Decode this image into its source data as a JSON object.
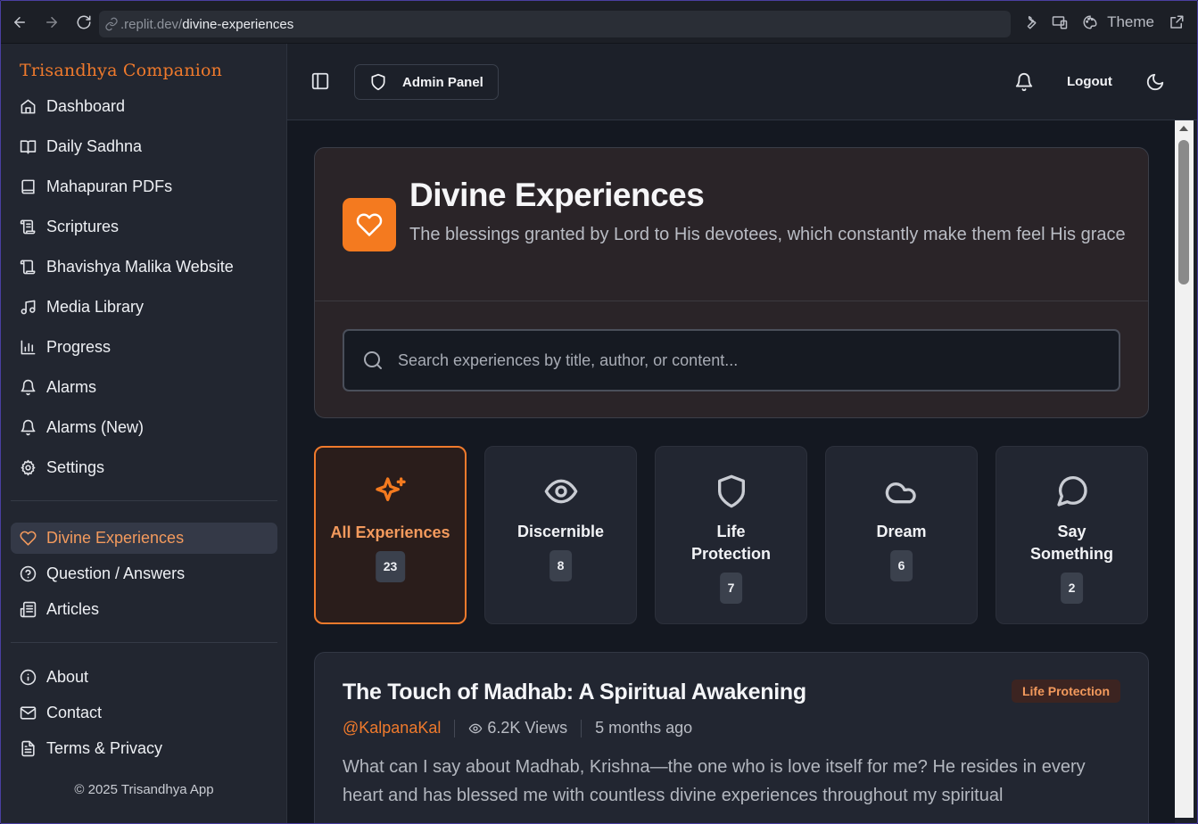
{
  "browser": {
    "url_domain": ".replit.dev/",
    "url_path": "divine-experiences",
    "theme_label": "Theme"
  },
  "sidebar": {
    "brand": "Trisandhya Companion",
    "items": [
      {
        "label": "Dashboard",
        "icon": "home-icon"
      },
      {
        "label": "Daily Sadhna",
        "icon": "book-open-icon"
      },
      {
        "label": "Mahapuran PDFs",
        "icon": "book-icon"
      },
      {
        "label": "Scriptures",
        "icon": "scroll-icon"
      },
      {
        "label": "Bhavishya Malika Website",
        "icon": "scroll-icon"
      },
      {
        "label": "Media Library",
        "icon": "music-icon"
      },
      {
        "label": "Progress",
        "icon": "bar-chart-icon"
      },
      {
        "label": "Alarms",
        "icon": "bell-icon"
      },
      {
        "label": "Alarms (New)",
        "icon": "bell-icon"
      },
      {
        "label": "Settings",
        "icon": "gear-icon"
      }
    ],
    "secondary": [
      {
        "label": "Divine Experiences",
        "icon": "heart-icon",
        "active": true
      },
      {
        "label": "Question / Answers",
        "icon": "help-circle-icon"
      },
      {
        "label": "Articles",
        "icon": "newspaper-icon"
      }
    ],
    "footer_links": [
      {
        "label": "About",
        "icon": "info-icon"
      },
      {
        "label": "Contact",
        "icon": "mail-icon"
      },
      {
        "label": "Terms & Privacy",
        "icon": "file-text-icon"
      }
    ],
    "copyright": "© 2025 Trisandhya App"
  },
  "header": {
    "admin_label": "Admin Panel",
    "logout_label": "Logout"
  },
  "hero": {
    "title": "Divine Experiences",
    "subtitle": "The blessings granted by Lord to His devotees, which constantly make them feel His grace",
    "search_placeholder": "Search experiences by title, author, or content..."
  },
  "categories": [
    {
      "label": "All Experiences",
      "count": "23",
      "icon": "sparkles-icon",
      "active": true
    },
    {
      "label": "Discernible",
      "count": "8",
      "icon": "eye-icon"
    },
    {
      "label": "Life Protection",
      "count": "7",
      "icon": "shield-icon"
    },
    {
      "label": "Dream",
      "count": "6",
      "icon": "cloud-icon"
    },
    {
      "label": "Say Something",
      "count": "2",
      "icon": "message-circle-icon"
    }
  ],
  "post": {
    "title": "The Touch of Madhab: A Spiritual Awakening",
    "tag": "Life Protection",
    "author": "@KalpanaKal",
    "views": "6.2K Views",
    "time": "5 months ago",
    "body": "What can I say about Madhab, Krishna—the one who is love itself for me? He resides in every heart and has blessed me with countless divine experiences throughout my spiritual"
  },
  "colors": {
    "accent": "#f47a1f",
    "sidebar_bg": "#222630",
    "main_bg": "#141821"
  }
}
